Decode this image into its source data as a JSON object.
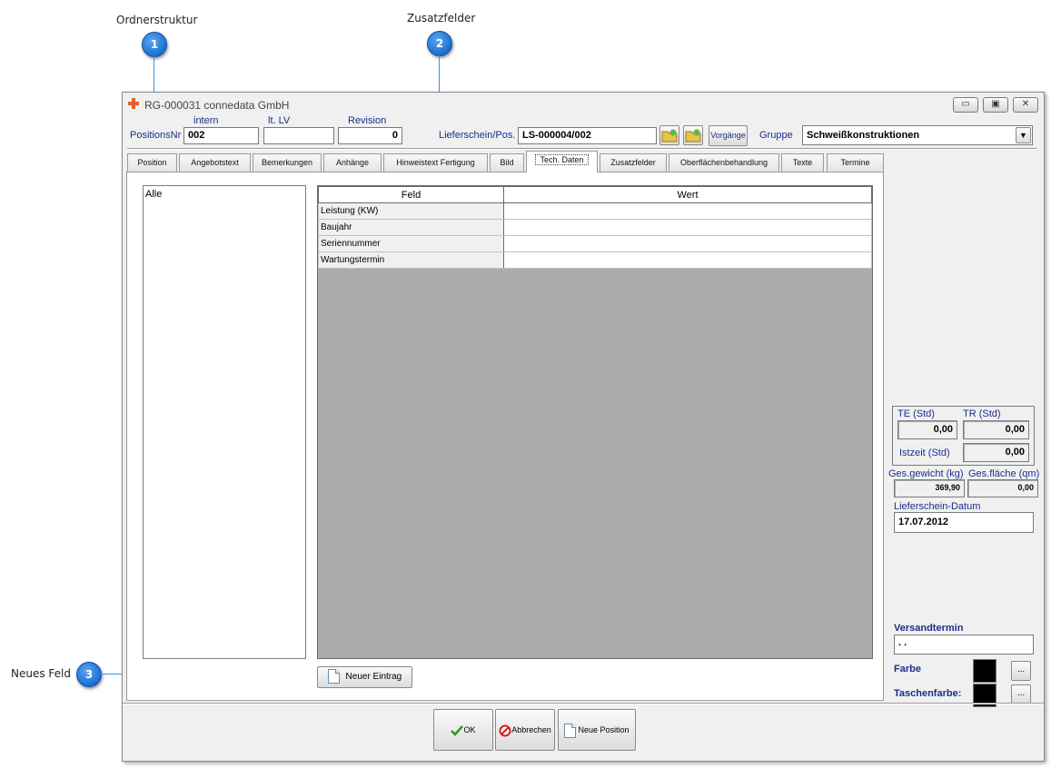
{
  "callouts": [
    {
      "num": "1",
      "label": "Ordnerstruktur"
    },
    {
      "num": "2",
      "label": "Zusatzfelder"
    },
    {
      "num": "3",
      "label": "Neues Feld"
    }
  ],
  "window": {
    "title": "RG-000031 connedata GmbH",
    "controls": {
      "minimize": "▭",
      "restore": "▣",
      "close": "✕"
    }
  },
  "header": {
    "positionsnr_label": "PositionsNr",
    "intern_label": "intern",
    "intern_value": "002",
    "ltlv_label": "lt. LV",
    "ltlv_value": "",
    "revision_label": "Revision",
    "revision_value": "0",
    "lieferschein_label": "Lieferschein/Pos.",
    "lieferschein_value": "LS-000004/002",
    "vorgaenge_label": "Vorgänge",
    "gruppe_label": "Gruppe",
    "gruppe_value": "Schweißkonstruktionen"
  },
  "tabs": [
    "Position",
    "Angebotstext",
    "Bemerkungen",
    "Anhänge",
    "Hinweistext Fertigung",
    "Bild",
    "Tech. Daten",
    "Zusatzfelder",
    "Oberflächenbehandlung",
    "Texte",
    "Termine"
  ],
  "active_tab": "Tech. Daten",
  "tree": {
    "root": "Alle"
  },
  "grid": {
    "columns": [
      "Feld",
      "Wert"
    ],
    "rows": [
      {
        "feld": "Leistung (KW)",
        "wert": ""
      },
      {
        "feld": "Baujahr",
        "wert": ""
      },
      {
        "feld": "Seriennummer",
        "wert": ""
      },
      {
        "feld": "Wartungstermin",
        "wert": ""
      }
    ]
  },
  "new_entry_label": "Neuer Eintrag",
  "times": {
    "te_label": "TE (Std)",
    "te_value": "0,00",
    "tr_label": "TR (Std)",
    "tr_value": "0,00",
    "istzeit_label": "Istzeit (Std)",
    "istzeit_value": "0,00"
  },
  "weights": {
    "gewicht_label": "Ges.gewicht (kg)",
    "gewicht_value": "369,90",
    "flaeche_label": "Ges.fläche (qm)",
    "flaeche_value": "0,00"
  },
  "lieferschein_datum": {
    "label": "Lieferschein-Datum",
    "value": "17.07.2012"
  },
  "versandtermin": {
    "label": "Versandtermin",
    "value": " .  ."
  },
  "farbe": {
    "label": "Farbe",
    "color": "#000000",
    "button": "..."
  },
  "taschenfarbe": {
    "label": "Taschenfarbe:",
    "color": "#000000",
    "button": "..."
  },
  "footer": {
    "ok": "OK",
    "abbrechen": "Abbrechen",
    "neue_position": "Neue Position"
  }
}
